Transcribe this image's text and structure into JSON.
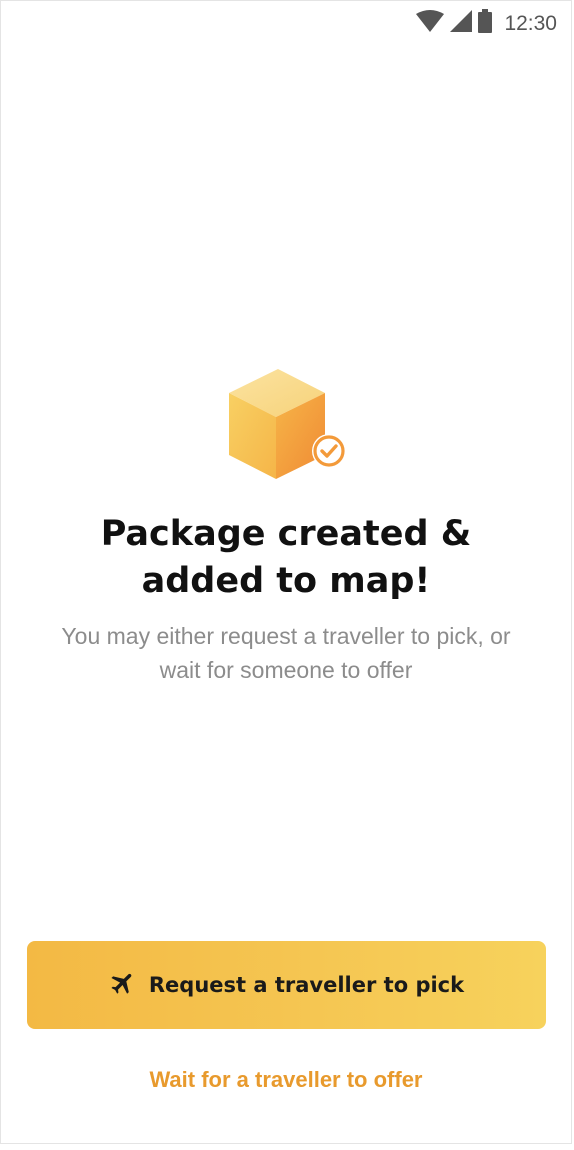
{
  "status_bar": {
    "time": "12:30",
    "icons": [
      "wifi-icon",
      "cell-signal-icon",
      "battery-icon"
    ]
  },
  "hero": {
    "icon": "package-box-check-icon",
    "accent_color": "#f39a3a"
  },
  "title": "Package created & added to map!",
  "subtitle": "You may either request a traveller to pick, or wait for someone to offer",
  "actions": {
    "primary_label": "Request a traveller to pick",
    "primary_icon": "airplane-icon",
    "secondary_label": "Wait for a traveller to offer"
  },
  "colors": {
    "primary_button": "#f5c652",
    "link": "#e89a2d",
    "title": "#111111",
    "subtitle": "#8c8c8c"
  }
}
